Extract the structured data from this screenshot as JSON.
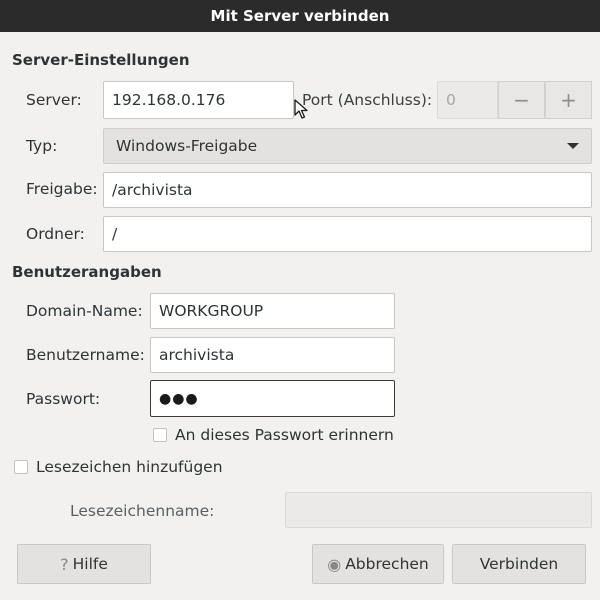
{
  "window": {
    "title": "Mit Server verbinden"
  },
  "server_settings": {
    "heading": "Server-Einstellungen",
    "server_label": "Server:",
    "server_value": "192.168.0.176",
    "port_label": "Port (Anschluss):",
    "port_value": "0",
    "port_minus": "−",
    "port_plus": "+",
    "type_label": "Typ:",
    "type_value": "Windows-Freigabe",
    "share_label": "Freigabe:",
    "share_value": "/archivista",
    "folder_label": "Ordner:",
    "folder_value": "/"
  },
  "user": {
    "heading": "Benutzerangaben",
    "domain_label": "Domain-Name:",
    "domain_value": "WORKGROUP",
    "username_label": "Benutzername:",
    "username_value": "archivista",
    "password_label": "Passwort:",
    "password_value": "●●●",
    "remember_label": "An dieses Passwort erinnern",
    "remember_checked": false
  },
  "bookmark": {
    "add_label": "Lesezeichen hinzufügen",
    "add_checked": false,
    "name_label": "Lesezeichenname:",
    "name_value": ""
  },
  "buttons": {
    "help_icon": "?",
    "help": "Hilfe",
    "cancel_icon": "◉",
    "cancel": "Abbrechen",
    "connect": "Verbinden"
  },
  "icons": {
    "help": "question-icon",
    "cancel": "cancel-icon",
    "dropdown": "chevron-down-icon",
    "cursor": "mouse-cursor-icon"
  }
}
